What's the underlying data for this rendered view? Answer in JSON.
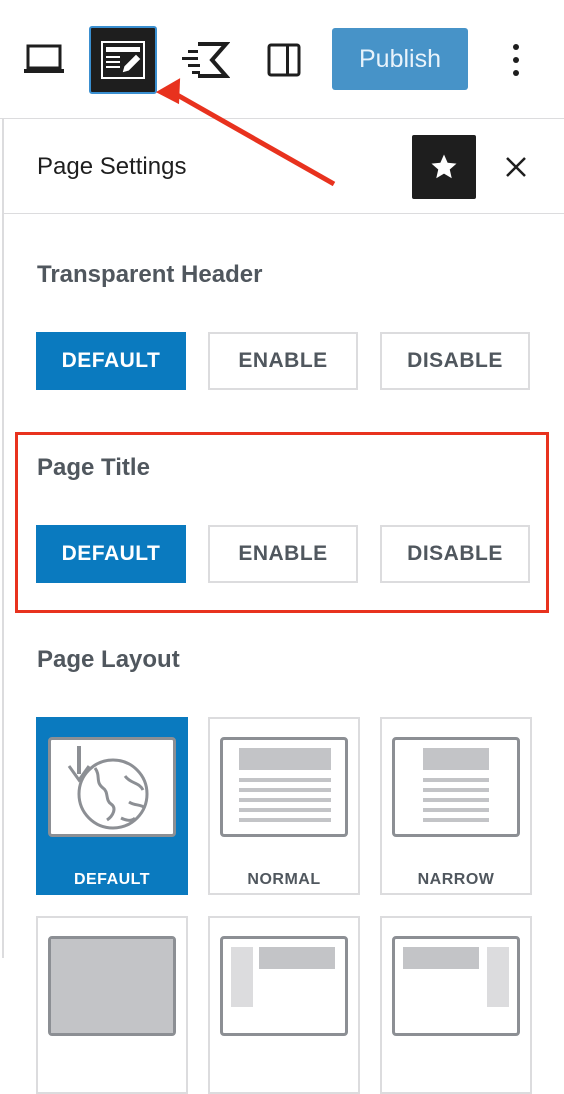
{
  "toolbar": {
    "publish_label": "Publish",
    "icons": [
      "laptop-icon",
      "page-settings-icon",
      "astra-icon",
      "sidebar-toggle-icon",
      "more-options-icon"
    ]
  },
  "panel": {
    "title": "Page Settings"
  },
  "sections": {
    "transparent_header": {
      "title": "Transparent Header",
      "options": [
        "DEFAULT",
        "ENABLE",
        "DISABLE"
      ],
      "selected": "DEFAULT"
    },
    "page_title": {
      "title": "Page Title",
      "options": [
        "DEFAULT",
        "ENABLE",
        "DISABLE"
      ],
      "selected": "DEFAULT"
    },
    "page_layout": {
      "title": "Page Layout",
      "options": [
        "DEFAULT",
        "NORMAL",
        "NARROW"
      ],
      "selected": "DEFAULT"
    }
  },
  "colors": {
    "accent": "#0a7abf",
    "annotation": "#e8321e",
    "publish": "#4793c8"
  }
}
